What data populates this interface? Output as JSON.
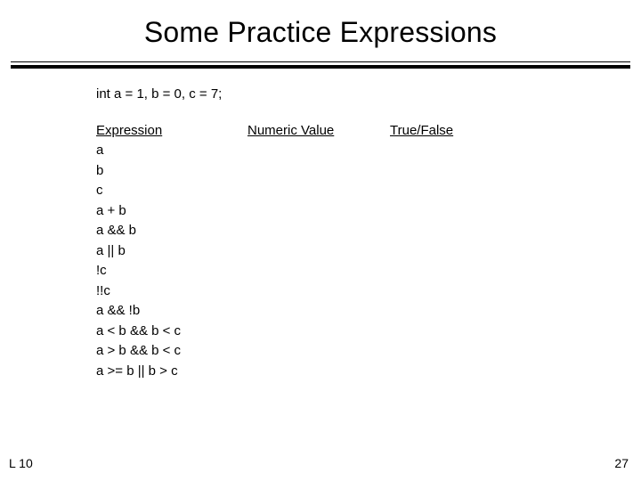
{
  "title": "Some Practice Expressions",
  "declaration": "int a = 1, b = 0, c = 7;",
  "headers": {
    "expression": "Expression",
    "numeric": "Numeric Value",
    "truefalse": "True/False"
  },
  "expressions": [
    "a",
    "b",
    "c",
    "a + b",
    "a && b",
    "a || b",
    "!c",
    "!!c",
    "a && !b",
    "a < b && b < c",
    "a > b && b < c",
    "a >= b || b > c"
  ],
  "footer": {
    "left": "L 10",
    "right": "27"
  }
}
